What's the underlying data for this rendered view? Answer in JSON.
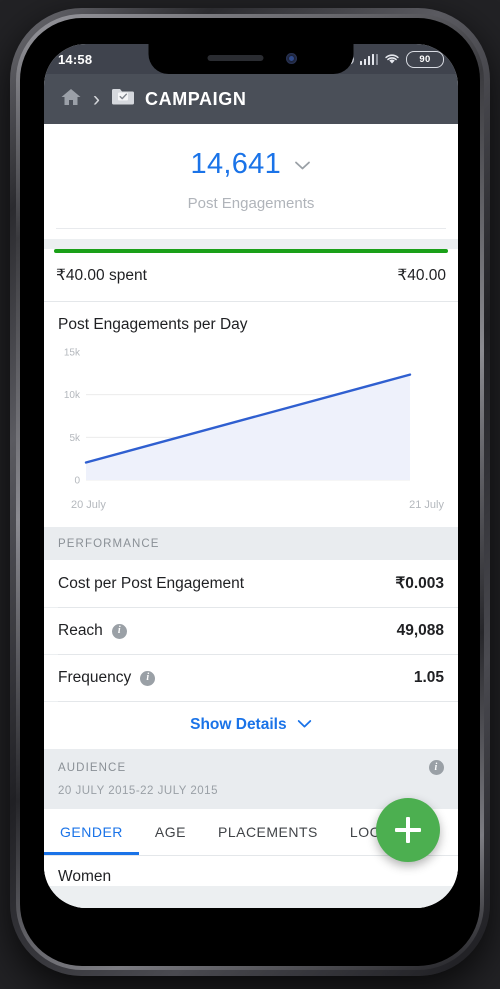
{
  "status_bar": {
    "time": "14:58",
    "battery_level": "90",
    "icons": [
      "do-not-disturb-moon-icon",
      "cellular-signal-icon",
      "wifi-icon",
      "battery-icon"
    ]
  },
  "navbar": {
    "home_icon": "home-icon",
    "separator": "›",
    "folder_icon": "folder-check-icon",
    "title": "CAMPAIGN"
  },
  "metric": {
    "value": "14,641",
    "caret_icon": "chevron-down-icon",
    "label": "Post Engagements"
  },
  "spend": {
    "progress_percent": 100,
    "spent_label": "₹40.00 spent",
    "budget_label": "₹40.00",
    "bar_color": "#1aa018"
  },
  "chart_data": {
    "type": "area",
    "title": "Post Engagements per Day",
    "xlabel": "",
    "ylabel": "",
    "x": [
      "20 July",
      "21 July"
    ],
    "categories": [
      "20 July",
      "21 July"
    ],
    "values": [
      2050,
      12350
    ],
    "series": [
      {
        "name": "Post Engagements per Day",
        "values": [
          2050,
          12350
        ]
      }
    ],
    "ylim": [
      0,
      15000
    ],
    "yticks": [
      0,
      5000,
      10000,
      15000
    ],
    "ytick_labels": [
      "0",
      "5k",
      "10k",
      "15k"
    ],
    "xtick_labels": [
      "20 July",
      "21 July"
    ],
    "grid": true,
    "legend": "none",
    "line_color": "#2f5fd0",
    "fill_color": "#eef1fb"
  },
  "performance": {
    "section_title": "PERFORMANCE",
    "rows": [
      {
        "label": "Cost per Post Engagement",
        "value": "₹0.003",
        "has_info": false
      },
      {
        "label": "Reach",
        "value": "49,088",
        "has_info": true,
        "info_icon": "info-icon"
      },
      {
        "label": "Frequency",
        "value": "1.05",
        "has_info": true,
        "info_icon": "info-icon"
      }
    ],
    "show_details_label": "Show Details",
    "show_details_caret": "chevron-down-icon"
  },
  "audience": {
    "section_title": "AUDIENCE",
    "info_icon": "info-icon",
    "date_range": "20 JULY 2015-22 JULY 2015",
    "tabs": [
      {
        "label": "GENDER",
        "active": true
      },
      {
        "label": "AGE",
        "active": false
      },
      {
        "label": "PLACEMENTS",
        "active": false
      },
      {
        "label": "LOCATIONS",
        "active": false
      }
    ],
    "first_row_label": "Women"
  },
  "fab": {
    "icon": "plus-icon",
    "color": "#4caf50"
  },
  "colors": {
    "accent_blue": "#1a73e8",
    "navbar": "#4a4f58",
    "statusbar": "#3f434d",
    "green": "#1aa018",
    "fab_green": "#4caf50",
    "page_bg": "#eceff1"
  }
}
